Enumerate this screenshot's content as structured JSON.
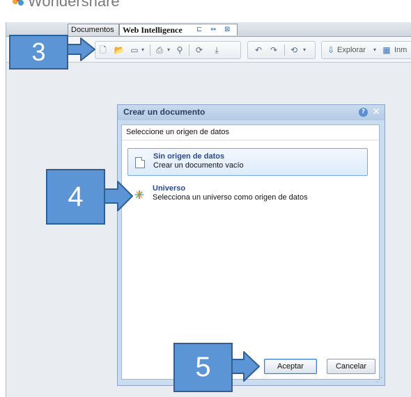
{
  "brand": {
    "name": "Wondershare"
  },
  "tabs": [
    {
      "label": "Documentos"
    },
    {
      "label": "Web Intelligence"
    }
  ],
  "toolbar": {
    "explore_label": "Explorar",
    "truncated_label": "Inm"
  },
  "dialog": {
    "title": "Crear un documento",
    "prompt": "Seleccione un origen de datos",
    "options": [
      {
        "title": "Sin origen de datos",
        "description": "Crear un documento vacío",
        "selected": true,
        "icon": "blank-document-icon"
      },
      {
        "title": "Universo",
        "description": "Selecciona un universo como origen de datos",
        "selected": false,
        "icon": "universe-icon"
      }
    ],
    "ok_label": "Aceptar",
    "cancel_label": "Cancelar"
  },
  "callouts": [
    {
      "number": "3"
    },
    {
      "number": "4"
    },
    {
      "number": "5"
    }
  ],
  "colors": {
    "callout_fill": "#5b95d5",
    "callout_border": "#2f5f95",
    "dialog_frame": "#c9dcf0",
    "option_title": "#2a4a8a"
  }
}
